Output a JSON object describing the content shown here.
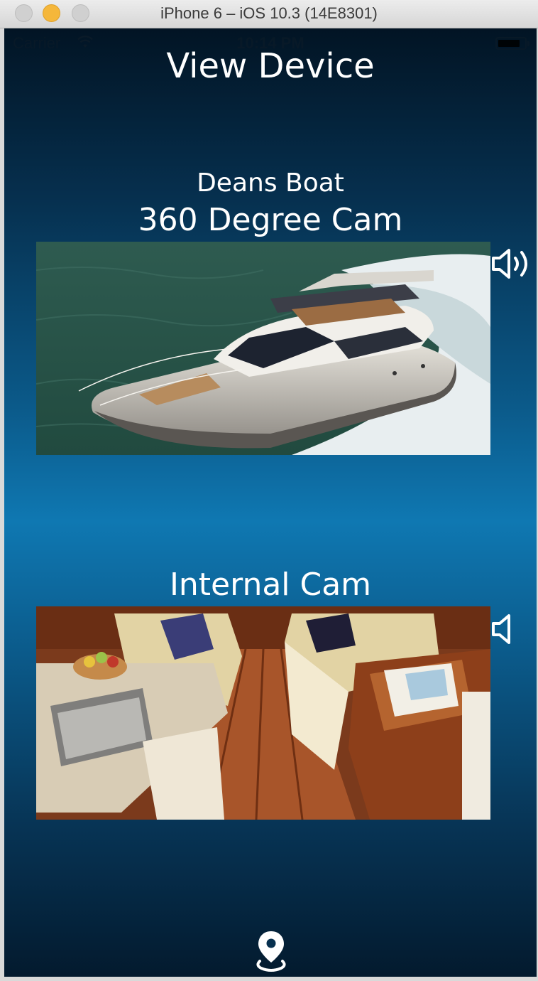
{
  "window": {
    "title": "iPhone 6 – iOS 10.3 (14E8301)"
  },
  "statusbar": {
    "carrier": "Carrier",
    "time": "10:14 PM"
  },
  "page": {
    "title": "View Device",
    "device_name": "Deans Boat"
  },
  "cameras": [
    {
      "label": "360 Degree Cam",
      "audio": "speaker-on-icon"
    },
    {
      "label": "Internal Cam",
      "audio": "speaker-muted-icon"
    }
  ],
  "footer": {
    "icon": "location-pin-icon"
  },
  "colors": {
    "screen_top": "#021424",
    "screen_mid": "#0f78b2",
    "screen_bottom": "#031a2e",
    "text": "#ffffff",
    "mac_min_button": "#f5b73b"
  }
}
